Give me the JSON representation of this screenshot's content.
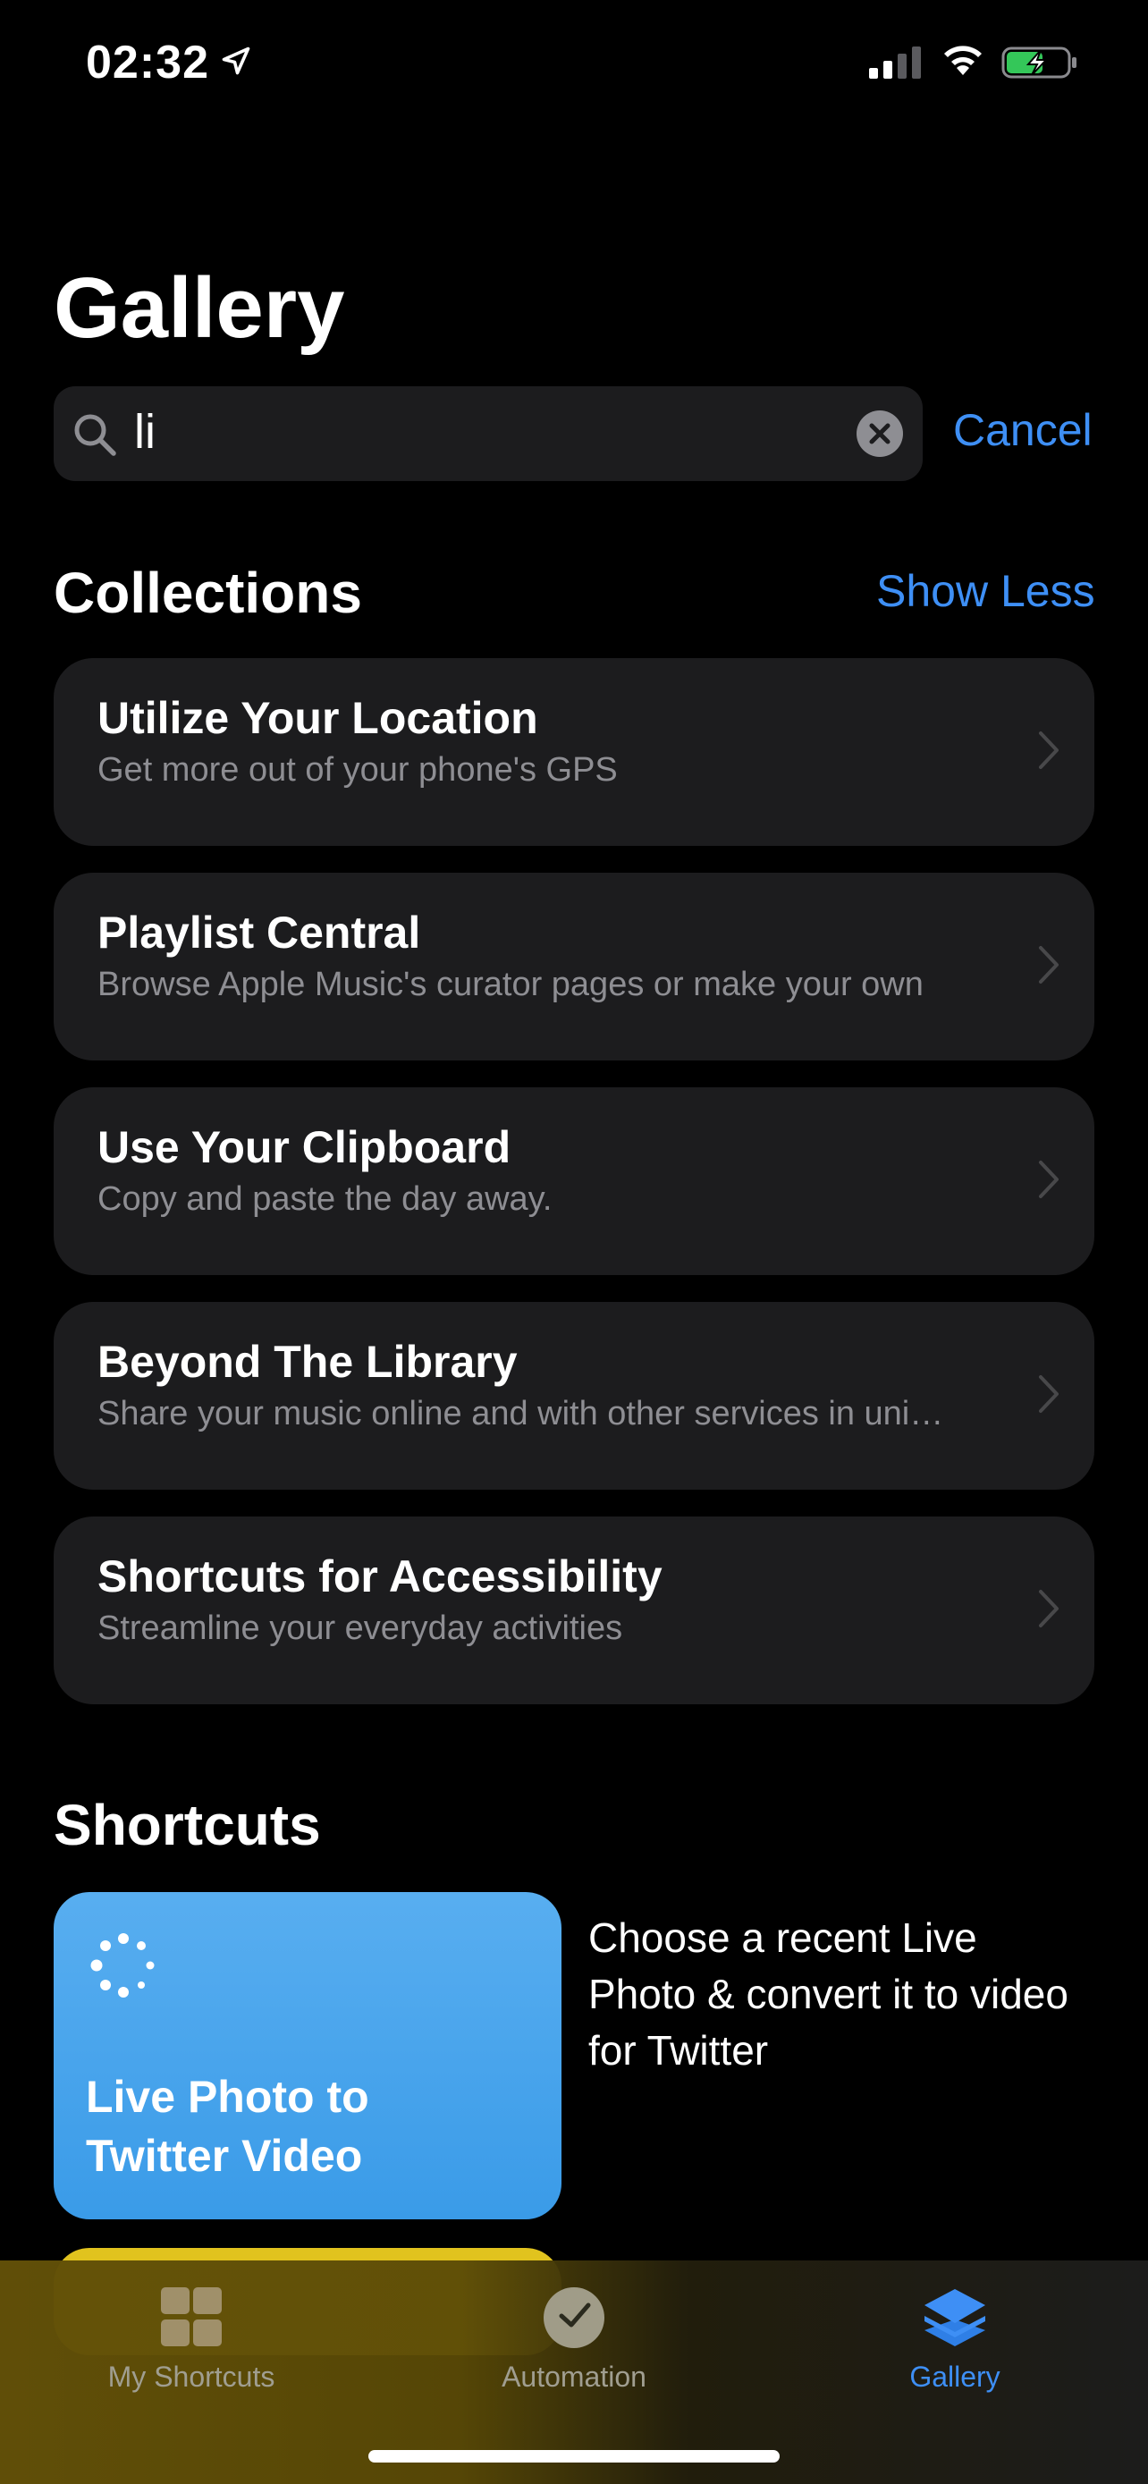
{
  "status_bar": {
    "time": "02:32"
  },
  "page": {
    "title": "Gallery"
  },
  "search": {
    "value": "li",
    "cancel_label": "Cancel"
  },
  "collections": {
    "title": "Collections",
    "toggle_label": "Show Less",
    "items": [
      {
        "title": "Utilize Your Location",
        "subtitle": "Get more out of your phone's GPS"
      },
      {
        "title": "Playlist Central",
        "subtitle": "Browse Apple Music's curator pages or make your own"
      },
      {
        "title": "Use Your Clipboard",
        "subtitle": "Copy and paste the day away."
      },
      {
        "title": "Beyond The Library",
        "subtitle": "Share your music online and with other services in uni…"
      },
      {
        "title": "Shortcuts for Accessibility",
        "subtitle": "Streamline your everyday activities"
      }
    ]
  },
  "shortcuts": {
    "title": "Shortcuts",
    "items": [
      {
        "title": "Live Photo to Twitter Video",
        "description": "Choose a recent Live Photo & convert it to video for Twitter",
        "color": "#4aa5ec",
        "icon": "live-photo-icon"
      }
    ]
  },
  "tab_bar": {
    "tabs": [
      {
        "label": "My Shortcuts",
        "icon": "grid-icon"
      },
      {
        "label": "Automation",
        "icon": "clock-check-icon"
      },
      {
        "label": "Gallery",
        "icon": "layers-icon",
        "active": true
      }
    ]
  },
  "colors": {
    "accent": "#3e8ff5",
    "card_bg": "#1c1c1e",
    "secondary_text": "#8e8e93"
  }
}
